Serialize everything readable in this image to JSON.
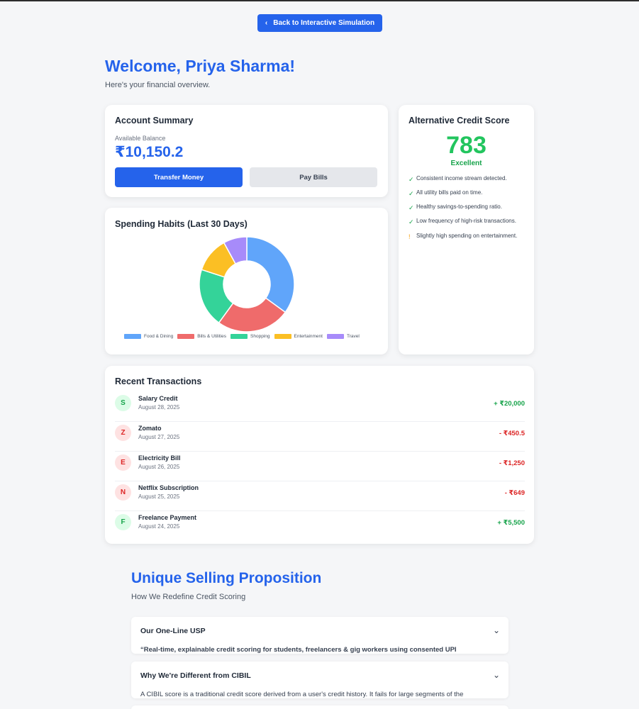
{
  "back_button": {
    "icon": "chevron-left-icon",
    "label": "Back to Interactive Simulation"
  },
  "welcome": {
    "title": "Welcome, Priya Sharma!",
    "subtitle": "Here's your financial overview."
  },
  "account_summary": {
    "title": "Account Summary",
    "balance_label": "Available Balance",
    "balance": "₹10,150.2",
    "transfer_label": "Transfer Money",
    "pay_bills_label": "Pay Bills"
  },
  "credit_score": {
    "title": "Alternative Credit Score",
    "score": "783",
    "rating": "Excellent",
    "factors": [
      {
        "mark": "✓",
        "type": "positive",
        "text": "Consistent income stream detected."
      },
      {
        "mark": "✓",
        "type": "positive",
        "text": "All utility bills paid on time."
      },
      {
        "mark": "✓",
        "type": "positive",
        "text": "Healthy savings-to-spending ratio."
      },
      {
        "mark": "✓",
        "type": "positive",
        "text": "Low frequency of high-risk transactions."
      },
      {
        "mark": "!",
        "type": "warning",
        "text": "Slightly high spending on entertainment."
      }
    ]
  },
  "spending": {
    "title": "Spending Habits (Last 30 Days)"
  },
  "chart_data": {
    "type": "pie",
    "categories": [
      "Food & Dining",
      "Bills & Utilities",
      "Shopping",
      "Entertainment",
      "Travel"
    ],
    "values": [
      35,
      25,
      20,
      12,
      8
    ],
    "colors": [
      "#60a5fa",
      "#ef6b6b",
      "#34d399",
      "#fbbf24",
      "#a78bfa"
    ],
    "legend_position": "bottom",
    "donut": true
  },
  "transactions": {
    "title": "Recent Transactions",
    "items": [
      {
        "initial": "S",
        "name": "Salary Credit",
        "date": "August 28, 2025",
        "amount": "+ ₹20,000",
        "kind": "credit"
      },
      {
        "initial": "Z",
        "name": "Zomato",
        "date": "August 27, 2025",
        "amount": "- ₹450.5",
        "kind": "debit"
      },
      {
        "initial": "E",
        "name": "Electricity Bill",
        "date": "August 26, 2025",
        "amount": "- ₹1,250",
        "kind": "debit"
      },
      {
        "initial": "N",
        "name": "Netflix Subscription",
        "date": "August 25, 2025",
        "amount": "- ₹649",
        "kind": "debit"
      },
      {
        "initial": "F",
        "name": "Freelance Payment",
        "date": "August 24, 2025",
        "amount": "+ ₹5,500",
        "kind": "credit"
      }
    ]
  },
  "usp": {
    "title": "Unique Selling Proposition",
    "subtitle": "How We Redefine Credit Scoring",
    "sections": [
      {
        "heading": "Our One-Line USP",
        "icon": "chevron-down-icon",
        "body": "“Real-time, explainable credit scoring for students, freelancers & gig workers using consented UPI"
      },
      {
        "heading": "Why We're Different from CIBIL",
        "icon": "chevron-down-icon",
        "body": "A CIBIL score is a traditional credit score derived from a user's credit history. It fails for large segments of the"
      }
    ]
  }
}
